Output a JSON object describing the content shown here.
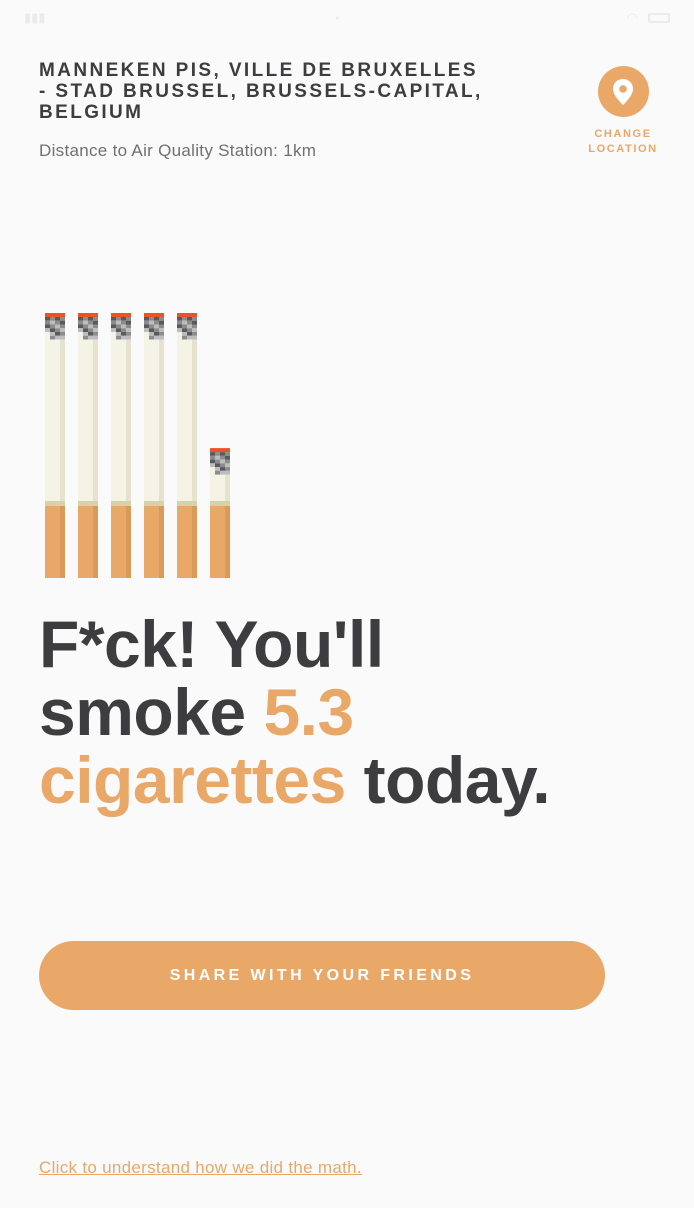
{
  "location": {
    "title": "MANNEKEN PIS, VILLE DE BRUXELLES - STAD BRUSSEL, BRUSSELS-CAPITAL, BELGIUM",
    "distance": "Distance to Air Quality Station: 1km"
  },
  "change_location": {
    "label_line1": "CHANGE",
    "label_line2": "LOCATION",
    "icon": "map-pin-icon"
  },
  "cigarettes": {
    "count": 5.3,
    "full": 5,
    "partial_fraction": 0.3,
    "icon": "cigarette-icon"
  },
  "headline": {
    "part1": "F*ck! You'll",
    "part2": "smoke ",
    "number": "5.3",
    "unit": "cigarettes",
    "part3": " today."
  },
  "share": {
    "label": "SHARE WITH YOUR FRIENDS"
  },
  "math_link": {
    "label": "Click to understand how we did the math."
  },
  "colors": {
    "accent": "#e9a868",
    "text": "#3d3d3f",
    "background": "#fafafb"
  }
}
